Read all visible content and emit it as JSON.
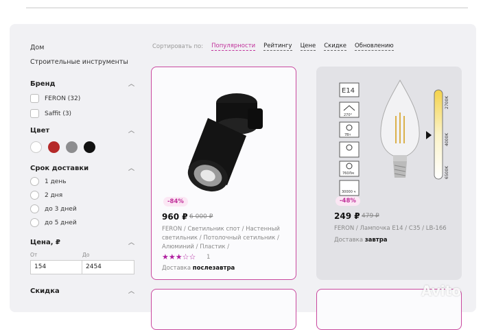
{
  "breadcrumbs": [
    "Дом",
    "Строительные инструменты"
  ],
  "filters": {
    "brand": {
      "title": "Бренд",
      "options": [
        "FERON (32)",
        "Saffit (3)"
      ]
    },
    "color": {
      "title": "Цвет",
      "swatches": [
        "#ffffff",
        "#b52a2a",
        "#8d8d8f",
        "#111111"
      ]
    },
    "delivery": {
      "title": "Срок доставки",
      "options": [
        "1 день",
        "2 дня",
        "до 3 дней",
        "до 5 дней"
      ]
    },
    "price": {
      "title": "Цена, ₽",
      "from_label": "От",
      "to_label": "До",
      "from_value": "154",
      "to_value": "2454"
    },
    "discount": {
      "title": "Скидка"
    }
  },
  "sort": {
    "label": "Сортировать по:",
    "options": [
      "Популярности",
      "Рейтингу",
      "Цене",
      "Скидке",
      "Обновлению"
    ],
    "active": "Популярности"
  },
  "products": [
    {
      "discount": "-84%",
      "price": "960 ₽",
      "old_price": "6 000 ₽",
      "title": "FERON / Светильник спот / Настенный светильник / Потолочный сетильник / Алюминий / Пластик /",
      "rating_stars": 3,
      "rating_max": 5,
      "rating_count": "1",
      "delivery_label": "Доставка",
      "delivery_value": "послезавтра"
    },
    {
      "discount": "-48%",
      "price": "249 ₽",
      "old_price": "479 ₽",
      "title": "FERON / Лампочка E14 / C35 / LB-166",
      "delivery_label": "Доставка",
      "delivery_value": "завтра",
      "image_labels": {
        "socket": "E14",
        "angle": "270°",
        "watt": "7Вт",
        "lumen": "760Лм",
        "hours": "30000 ч",
        "temps": [
          "2700K",
          "4000K",
          "6500K"
        ]
      }
    }
  ],
  "watermark": "Avito"
}
